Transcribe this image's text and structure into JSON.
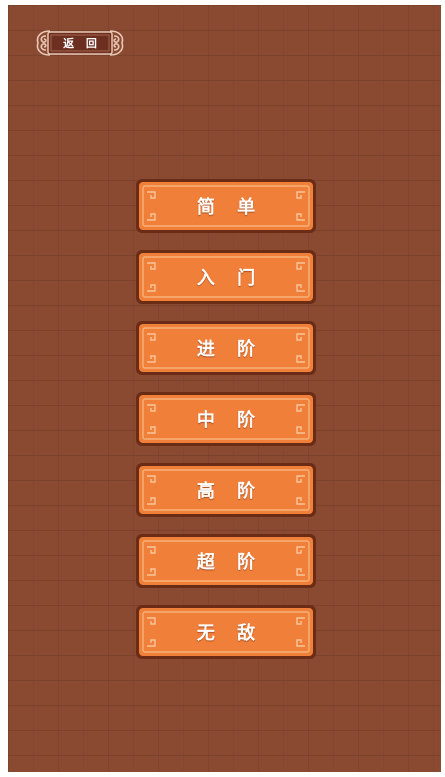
{
  "header": {
    "back_label": "返 回"
  },
  "levels": [
    {
      "label": "简 单"
    },
    {
      "label": "入 门"
    },
    {
      "label": "进 阶"
    },
    {
      "label": "中 阶"
    },
    {
      "label": "高 阶"
    },
    {
      "label": "超 阶"
    },
    {
      "label": "无 敌"
    }
  ],
  "colors": {
    "background": "#8a4a31",
    "button_face": "#f07f3a",
    "button_border": "#6b2c16",
    "button_trim": "#f7b27a",
    "label_text": "#ffffff"
  },
  "icons": {
    "back_ornament": "scroll-cloud-ornament",
    "button_corner": "fret-corner-ornament"
  }
}
